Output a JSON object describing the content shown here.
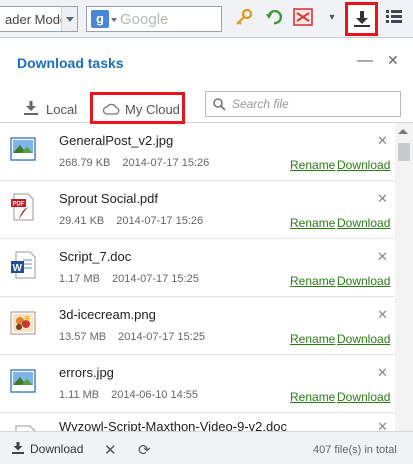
{
  "toolbar": {
    "reader_mode_label": "ader Mode",
    "search_engine_logo": "g",
    "search_placeholder": "Google",
    "icons": [
      "key-icon",
      "undo-icon",
      "screenshot-icon",
      "caret-icon",
      "download-icon",
      "menu-icon"
    ]
  },
  "panel": {
    "title": "Download tasks",
    "minimize_glyph": "—",
    "close_glyph": "✕"
  },
  "tabs": {
    "local_label": "Local",
    "cloud_label": "My Cloud",
    "search_placeholder": "Search file"
  },
  "files": [
    {
      "name": "GeneralPost_v2.jpg",
      "size": "268.79 KB",
      "date": "2014-07-17 15:26",
      "type": "image"
    },
    {
      "name": "Sprout Social.pdf",
      "size": "29.41 KB",
      "date": "2014-07-17 15:26",
      "type": "pdf"
    },
    {
      "name": "Script_7.doc",
      "size": "1.17 MB",
      "date": "2014-07-17 15:25",
      "type": "doc"
    },
    {
      "name": "3d-icecream.png",
      "size": "13.57 MB",
      "date": "2014-07-17 15:25",
      "type": "png"
    },
    {
      "name": "errors.jpg",
      "size": "1.11 MB",
      "date": "2014-06-10 14:55",
      "type": "image"
    },
    {
      "name": "Wyzowl-Script-Maxthon-Video-9-v2.doc",
      "size": "",
      "date": "",
      "type": "doc"
    }
  ],
  "actions": {
    "rename": "Rename",
    "download": "Download",
    "close": "✕"
  },
  "footer": {
    "download_label": "Download",
    "total_text": "407 file(s) in total"
  },
  "colors": {
    "accent": "#1a6fc2",
    "link": "#2a7d13",
    "highlight": "#e8141c"
  }
}
